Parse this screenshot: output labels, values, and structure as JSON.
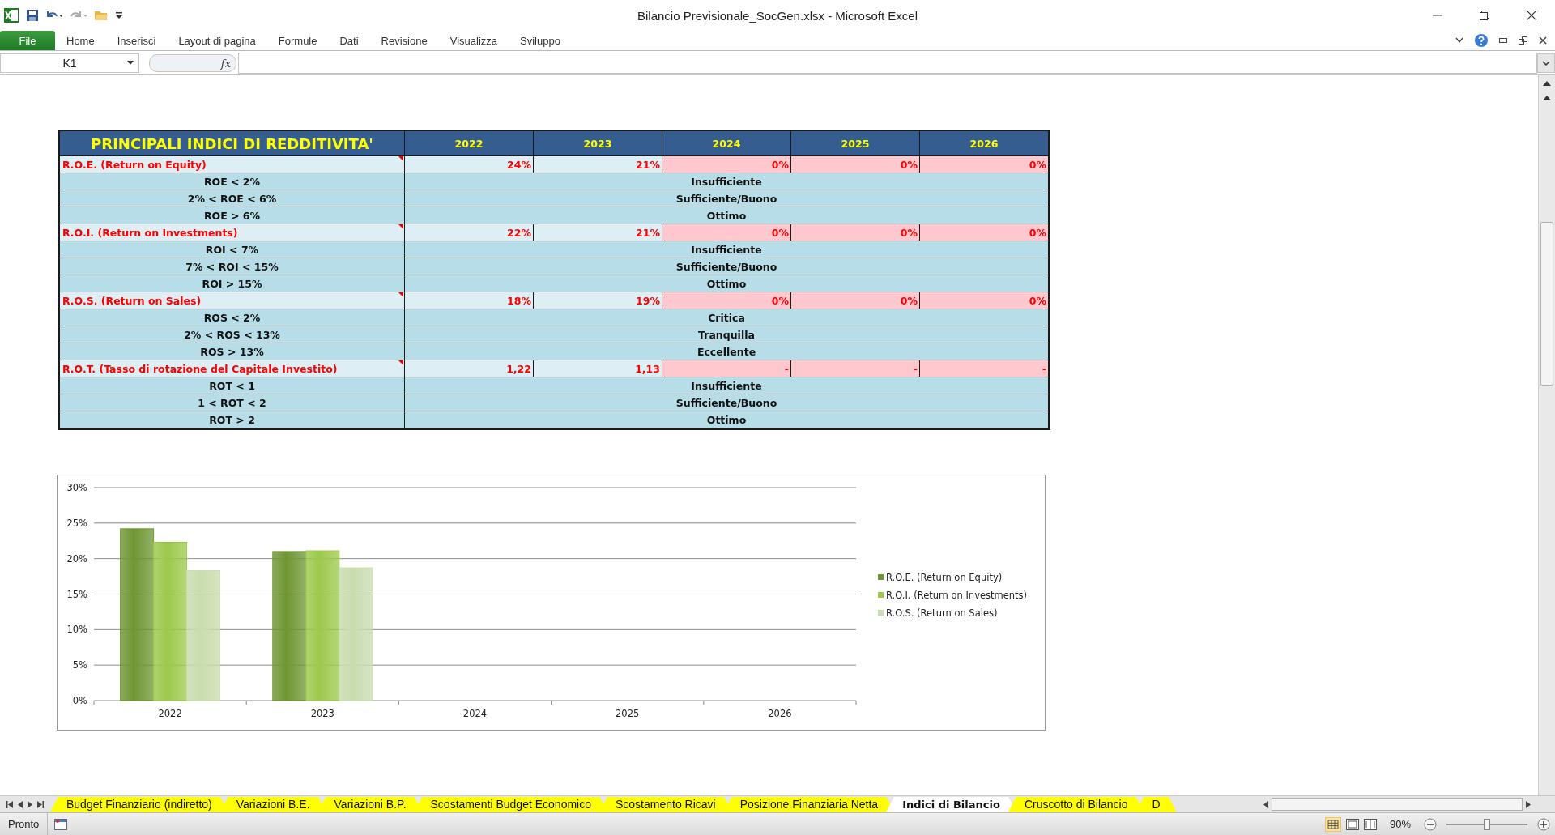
{
  "window": {
    "title": "Bilancio Previsionale_SocGen.xlsx  -  Microsoft Excel"
  },
  "ribbon": {
    "file_button": "File",
    "tabs": [
      {
        "label": "Home",
        "selected": false
      },
      {
        "label": "Inserisci",
        "selected": false
      },
      {
        "label": "Layout di pagina",
        "selected": false
      },
      {
        "label": "Formule",
        "selected": false
      },
      {
        "label": "Dati",
        "selected": false
      },
      {
        "label": "Revisione",
        "selected": false
      },
      {
        "label": "Visualizza",
        "selected": false
      },
      {
        "label": "Sviluppo",
        "selected": false
      }
    ]
  },
  "formula_bar": {
    "name_box": "K1",
    "function_symbol": "fx"
  },
  "table": {
    "title": "PRINCIPALI INDICI DI REDDITIVITA'",
    "years": [
      "2022",
      "2023",
      "2024",
      "2025",
      "2026"
    ],
    "sections": [
      {
        "label": "R.O.E. (Return on Equity)",
        "values": [
          {
            "text": "24%",
            "flagged": false
          },
          {
            "text": "21%",
            "flagged": false
          },
          {
            "text": "0%",
            "flagged": true
          },
          {
            "text": "0%",
            "flagged": true
          },
          {
            "text": "0%",
            "flagged": true
          }
        ],
        "criteria": [
          {
            "condition": "ROE < 2%",
            "rating": "Insufficiente"
          },
          {
            "condition": "2% < ROE < 6%",
            "rating": "Sufficiente/Buono"
          },
          {
            "condition": "ROE > 6%",
            "rating": "Ottimo"
          }
        ]
      },
      {
        "label": "R.O.I. (Return on Investments)",
        "values": [
          {
            "text": "22%",
            "flagged": false
          },
          {
            "text": "21%",
            "flagged": false
          },
          {
            "text": "0%",
            "flagged": true
          },
          {
            "text": "0%",
            "flagged": true
          },
          {
            "text": "0%",
            "flagged": true
          }
        ],
        "criteria": [
          {
            "condition": "ROI < 7%",
            "rating": "Insufficiente"
          },
          {
            "condition": "7% < ROI < 15%",
            "rating": "Sufficiente/Buono"
          },
          {
            "condition": "ROI > 15%",
            "rating": "Ottimo"
          }
        ]
      },
      {
        "label": "R.O.S. (Return on Sales)",
        "values": [
          {
            "text": "18%",
            "flagged": false
          },
          {
            "text": "19%",
            "flagged": false
          },
          {
            "text": "0%",
            "flagged": true
          },
          {
            "text": "0%",
            "flagged": true
          },
          {
            "text": "0%",
            "flagged": true
          }
        ],
        "criteria": [
          {
            "condition": "ROS < 2%",
            "rating": "Critica"
          },
          {
            "condition": "2% < ROS < 13%",
            "rating": "Tranquilla"
          },
          {
            "condition": "ROS > 13%",
            "rating": "Eccellente"
          }
        ]
      },
      {
        "label": "R.O.T. (Tasso di rotazione del Capitale Investito)",
        "values": [
          {
            "text": "1,22",
            "flagged": false
          },
          {
            "text": "1,13",
            "flagged": false
          },
          {
            "text": "-",
            "flagged": true
          },
          {
            "text": "-",
            "flagged": true
          },
          {
            "text": "-",
            "flagged": true
          }
        ],
        "criteria": [
          {
            "condition": "ROT < 1",
            "rating": "Insufficiente"
          },
          {
            "condition": "1 < ROT < 2",
            "rating": "Sufficiente/Buono"
          },
          {
            "condition": "ROT > 2",
            "rating": "Ottimo"
          }
        ]
      }
    ]
  },
  "chart": {
    "chart_data": {
      "type": "bar",
      "categories": [
        "2022",
        "2023",
        "2024",
        "2025",
        "2026"
      ],
      "series": [
        {
          "name": "R.O.E. (Return on Equity)",
          "color": "#6f9633",
          "values": [
            0.242,
            0.21,
            0,
            0,
            0
          ]
        },
        {
          "name": "R.O.I. (Return on Investments)",
          "color": "#9cc94c",
          "values": [
            0.223,
            0.211,
            0,
            0,
            0
          ]
        },
        {
          "name": "R.O.S. (Return on Sales)",
          "color": "#c9dcae",
          "values": [
            0.183,
            0.187,
            0,
            0,
            0
          ]
        }
      ],
      "grid": true,
      "legend": true,
      "ylim": [
        0,
        0.3
      ],
      "yticks": [
        {
          "value": 0,
          "label": "0%"
        },
        {
          "value": 0.05,
          "label": "5%"
        },
        {
          "value": 0.1,
          "label": "10%"
        },
        {
          "value": 0.15,
          "label": "15%"
        },
        {
          "value": 0.2,
          "label": "20%"
        },
        {
          "value": 0.25,
          "label": "25%"
        },
        {
          "value": 0.3,
          "label": "30%"
        }
      ]
    }
  },
  "sheet_tabs": [
    {
      "label": "Budget Finanziario (indiretto)",
      "selected": false
    },
    {
      "label": "Variazioni B.E.",
      "selected": false
    },
    {
      "label": "Variazioni B.P.",
      "selected": false
    },
    {
      "label": "Scostamenti Budget Economico",
      "selected": false
    },
    {
      "label": "Scostamento Ricavi",
      "selected": false
    },
    {
      "label": "Posizione Finanziaria Netta",
      "selected": false
    },
    {
      "label": "Indici di Bilancio",
      "selected": true
    },
    {
      "label": "Cruscotto di Bilancio",
      "selected": false
    },
    {
      "label": "D",
      "selected": false
    }
  ],
  "status_bar": {
    "status": "Pronto",
    "zoom": "90%",
    "zoom_slider": {
      "level": 0.5
    }
  }
}
